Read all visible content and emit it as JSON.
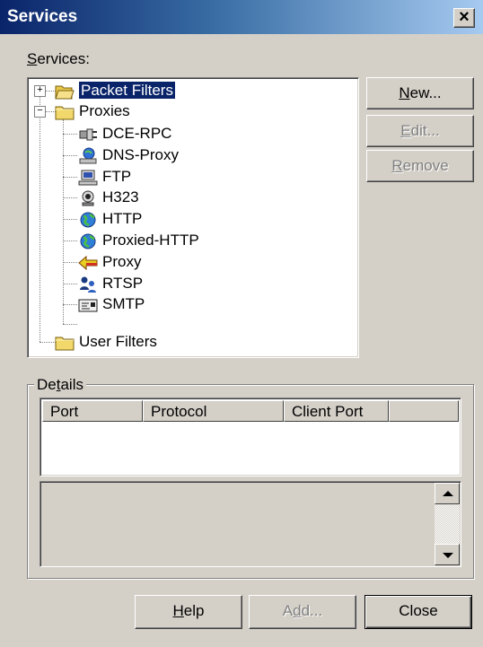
{
  "window": {
    "title": "Services",
    "close_glyph": "×"
  },
  "services_label": {
    "prefix": "",
    "accel": "S",
    "rest": "ervices:"
  },
  "tree": {
    "items": [
      {
        "label": "Packet Filters",
        "icon": "folder-open-icon"
      },
      {
        "label": "Proxies",
        "icon": "folder-icon"
      },
      {
        "label": "DCE-RPC",
        "icon": "plug-icon"
      },
      {
        "label": "DNS-Proxy",
        "icon": "dns-icon"
      },
      {
        "label": "FTP",
        "icon": "computer-icon"
      },
      {
        "label": "H323",
        "icon": "webcam-icon"
      },
      {
        "label": "HTTP",
        "icon": "globe-icon"
      },
      {
        "label": "Proxied-HTTP",
        "icon": "globe-icon"
      },
      {
        "label": "Proxy",
        "icon": "arrow-left-icon"
      },
      {
        "label": "RTSP",
        "icon": "users-icon"
      },
      {
        "label": "SMTP",
        "icon": "mail-icon"
      },
      {
        "label": "User Filters",
        "icon": "folder-icon"
      }
    ],
    "expander_plus": "+",
    "expander_minus": "−"
  },
  "buttons": {
    "new": {
      "accel": "N",
      "rest": "ew..."
    },
    "edit": {
      "accel": "E",
      "rest": "dit..."
    },
    "remove": {
      "accel": "R",
      "rest": "emove"
    },
    "help": {
      "accel": "H",
      "rest": "elp"
    },
    "add": {
      "pre": "A",
      "accel": "d",
      "rest": "d..."
    },
    "close": {
      "label": "Close"
    }
  },
  "details": {
    "label_pre": "De",
    "label_accel": "t",
    "label_rest": "ails",
    "columns": [
      "Port",
      "Protocol",
      "Client Port"
    ]
  },
  "colors": {
    "selection": "#0a246a",
    "face": "#d4d0c8",
    "title_start": "#0a246a"
  }
}
